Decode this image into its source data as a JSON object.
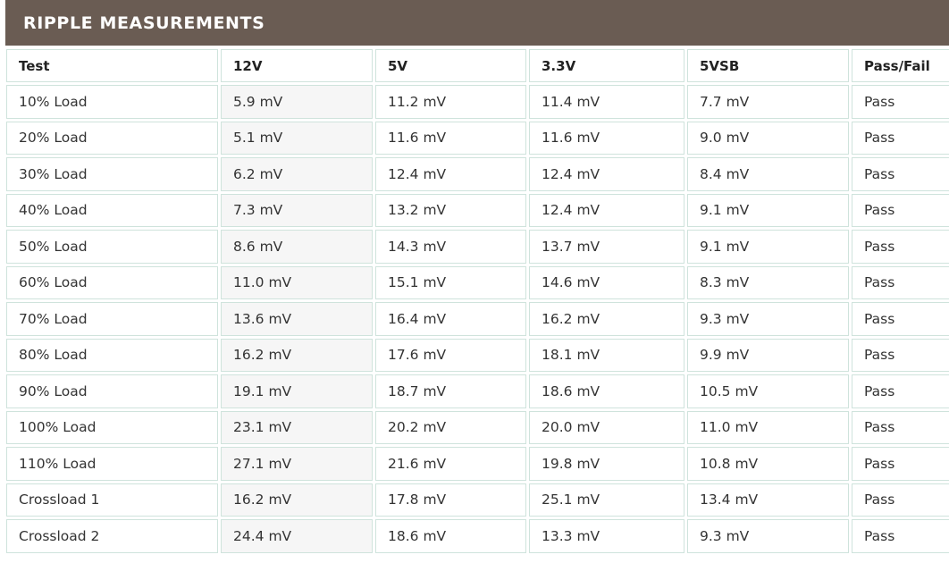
{
  "title": "RIPPLE MEASUREMENTS",
  "columns": [
    "Test",
    "12V",
    "5V",
    "3.3V",
    "5VSB",
    "Pass/Fail"
  ],
  "rows": [
    [
      "10% Load",
      "5.9 mV",
      "11.2 mV",
      "11.4 mV",
      "7.7 mV",
      "Pass"
    ],
    [
      "20% Load",
      "5.1 mV",
      "11.6 mV",
      "11.6 mV",
      "9.0 mV",
      "Pass"
    ],
    [
      "30% Load",
      "6.2 mV",
      "12.4 mV",
      "12.4 mV",
      "8.4 mV",
      "Pass"
    ],
    [
      "40% Load",
      "7.3 mV",
      "13.2 mV",
      "12.4 mV",
      "9.1 mV",
      "Pass"
    ],
    [
      "50% Load",
      "8.6 mV",
      "14.3 mV",
      "13.7 mV",
      "9.1 mV",
      "Pass"
    ],
    [
      "60% Load",
      "11.0 mV",
      "15.1 mV",
      "14.6 mV",
      "8.3 mV",
      "Pass"
    ],
    [
      "70% Load",
      "13.6 mV",
      "16.4 mV",
      "16.2 mV",
      "9.3 mV",
      "Pass"
    ],
    [
      "80% Load",
      "16.2 mV",
      "17.6 mV",
      "18.1 mV",
      "9.9 mV",
      "Pass"
    ],
    [
      "90% Load",
      "19.1 mV",
      "18.7 mV",
      "18.6 mV",
      "10.5 mV",
      "Pass"
    ],
    [
      "100% Load",
      "23.1 mV",
      "20.2 mV",
      "20.0 mV",
      "11.0 mV",
      "Pass"
    ],
    [
      "110% Load",
      "27.1 mV",
      "21.6 mV",
      "19.8 mV",
      "10.8 mV",
      "Pass"
    ],
    [
      "Crossload 1",
      "16.2 mV",
      "17.8 mV",
      "25.1 mV",
      "13.4 mV",
      "Pass"
    ],
    [
      "Crossload 2",
      "24.4 mV",
      "18.6 mV",
      "13.3 mV",
      "9.3 mV",
      "Pass"
    ]
  ],
  "colors": {
    "title_bg": "#6a5c53",
    "title_text": "#ffffff",
    "cell_border": "#cfe3dc",
    "highlight_column_bg": "#f6f6f6"
  }
}
